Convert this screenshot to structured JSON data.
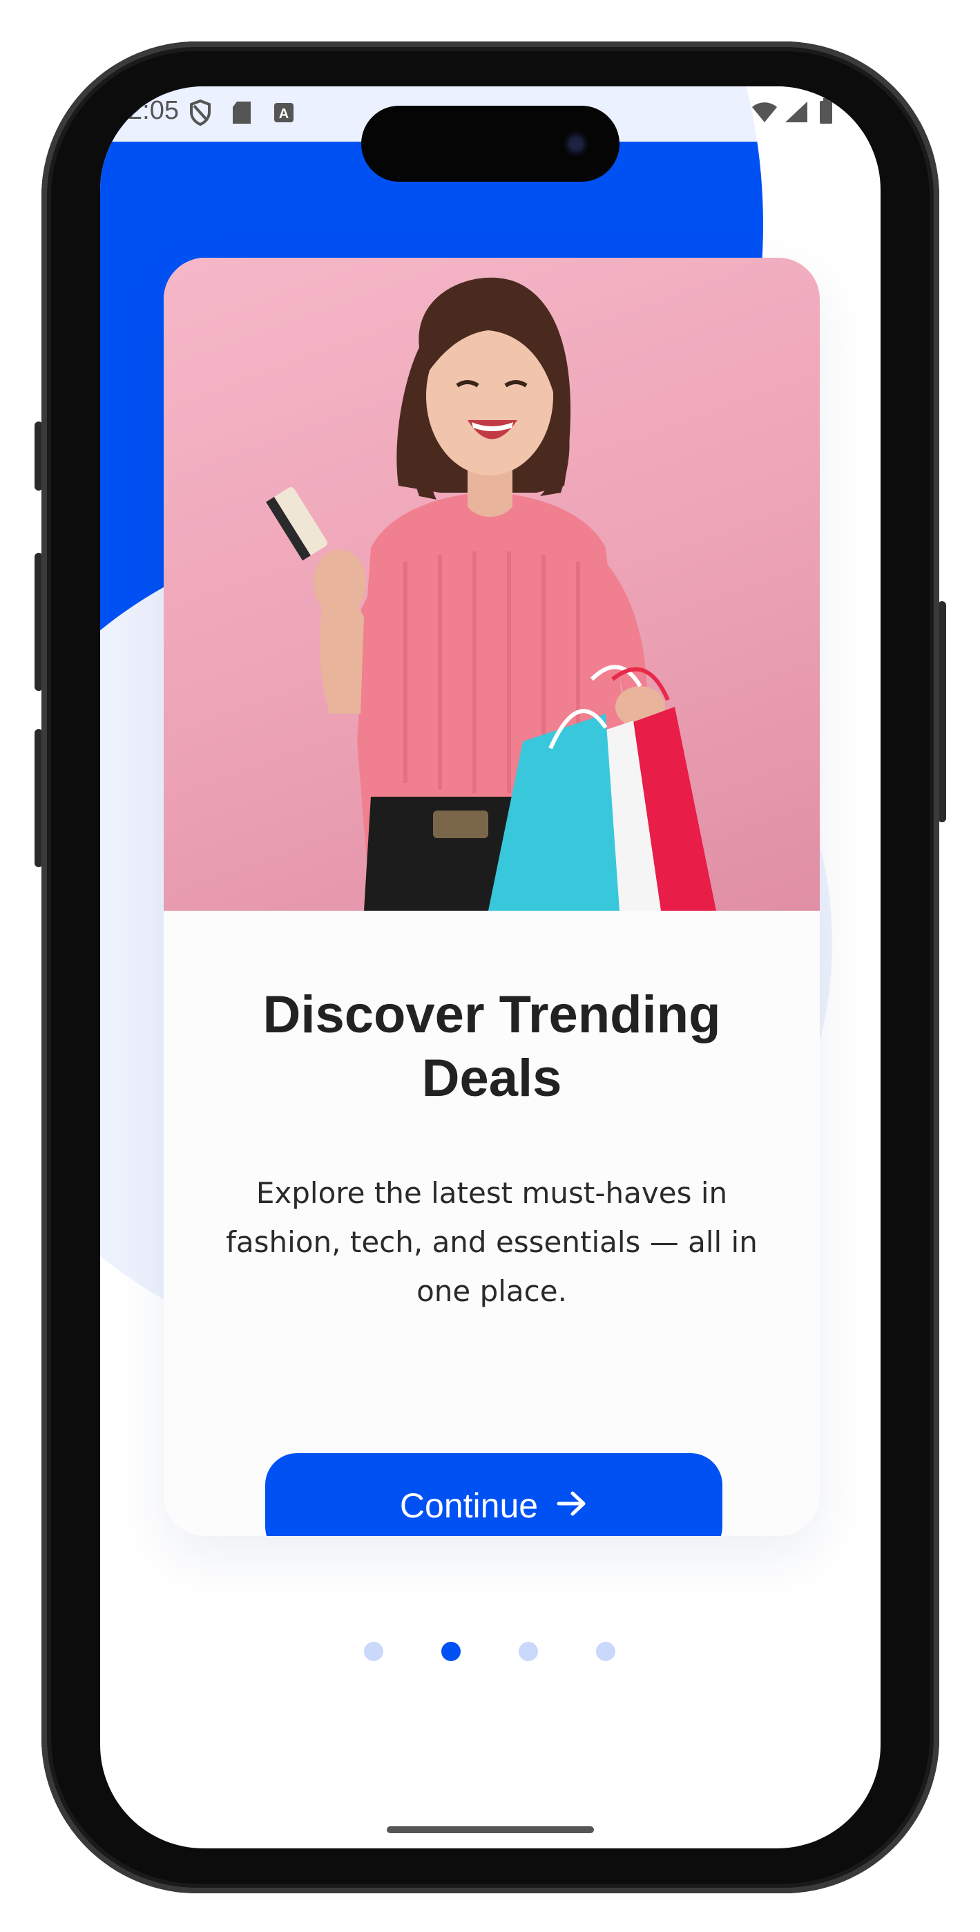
{
  "status_bar": {
    "time": "2:05",
    "left_icons": [
      "shield-icon",
      "sd-card-icon",
      "text-a-icon"
    ],
    "right_icons": [
      "wifi-icon",
      "signal-icon",
      "battery-icon"
    ]
  },
  "onboarding": {
    "image_alt": "Smiling woman holding a credit card and shopping bags",
    "title": "Discover Trending Deals",
    "description": "Explore the latest must-haves in fashion, tech, and essentials — all in one place.",
    "continue_label": "Continue",
    "continue_icon": "arrow-right-icon"
  },
  "pager": {
    "total": 4,
    "active_index": 1
  },
  "colors": {
    "accent": "#0051f4",
    "hero_bg": "#eda3b6",
    "inactive_dot": "#c9d8fb"
  }
}
